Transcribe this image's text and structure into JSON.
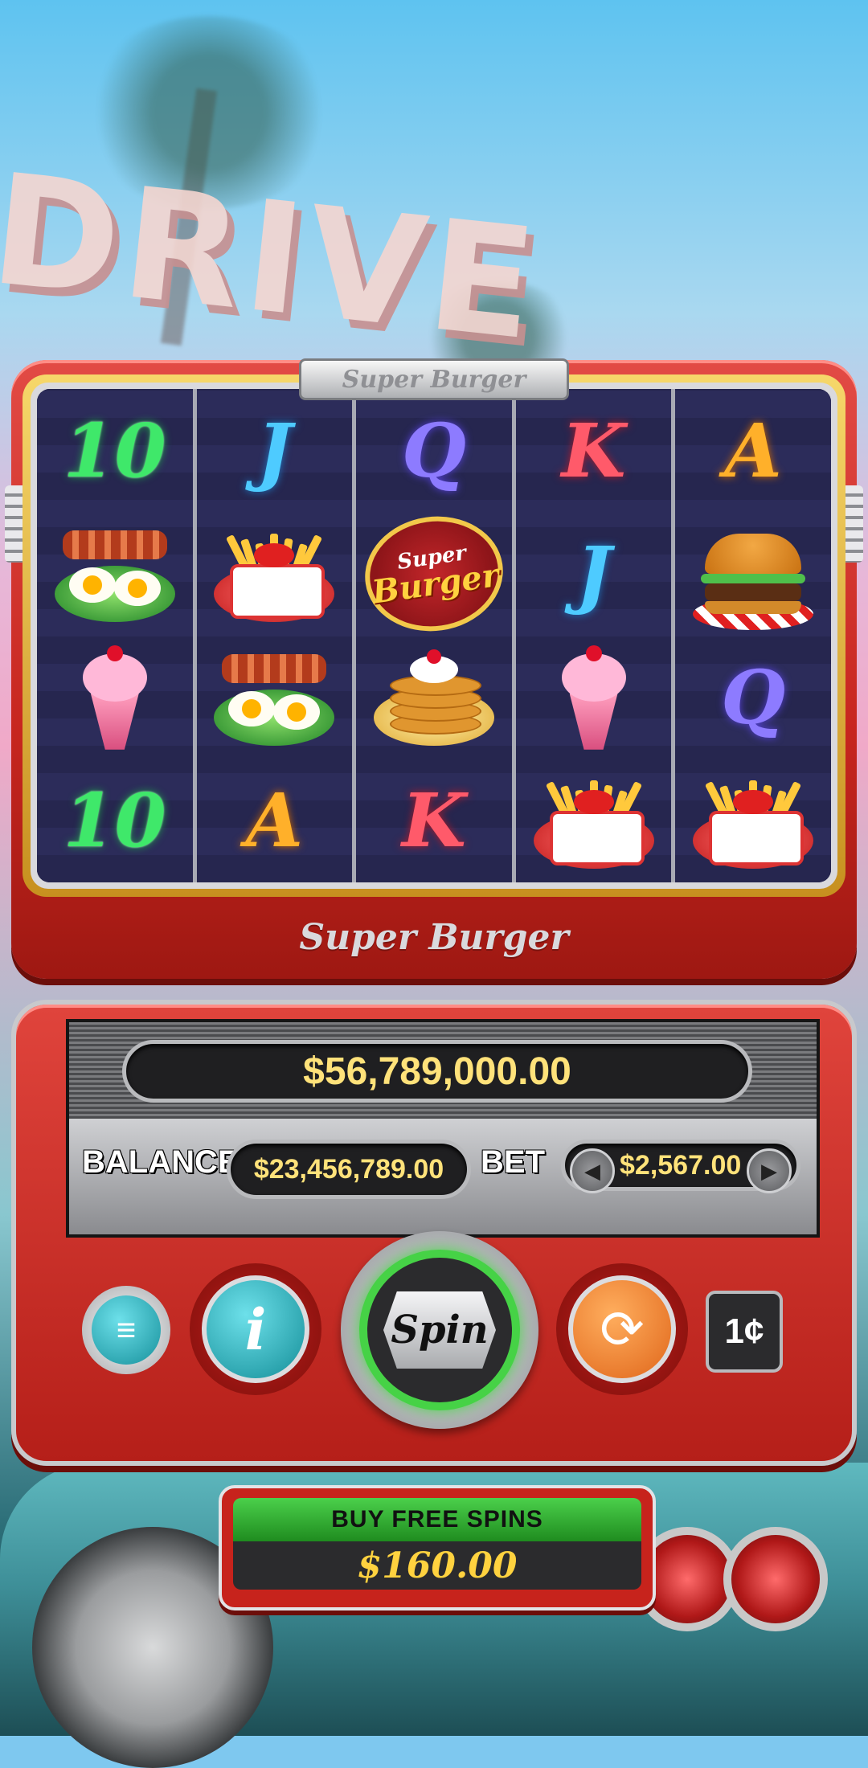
{
  "game": {
    "title": "Super Burger",
    "header_plaque": "Super Burger",
    "footer_logo": "Super Burger",
    "background_sign": "DRIVE"
  },
  "reels": [
    [
      "10",
      "eggs-bacon",
      "sundae",
      "10"
    ],
    [
      "J",
      "fries",
      "eggs-bacon",
      "A"
    ],
    [
      "Q",
      "super-burger-logo",
      "pancakes",
      "K"
    ],
    [
      "K",
      "J",
      "sundae",
      "fries"
    ],
    [
      "A",
      "burger",
      "Q",
      "fries"
    ]
  ],
  "logo_symbol": {
    "line1": "Super",
    "line2": "Burger"
  },
  "hud": {
    "win_display": "$56,789,000.00",
    "balance_label": "BALANCE",
    "balance_value": "$23,456,789.00",
    "bet_label": "BET",
    "bet_value": "$2,567.00",
    "denomination": "1¢"
  },
  "controls": {
    "menu_icon": "hamburger-menu-icon",
    "info_icon": "info-icon",
    "spin_label": "Spin",
    "autoplay_icon": "autoplay-icon",
    "bet_decrease_icon": "arrow-left-icon",
    "bet_increase_icon": "arrow-right-icon"
  },
  "buy_feature": {
    "label": "BUY FREE SPINS",
    "price": "$160.00"
  },
  "colors": {
    "cabinet_red": "#c7261f",
    "value_yellow": "#ffe27a",
    "spin_ring_green": "#46d246",
    "menu_teal": "#16909b",
    "autoplay_orange": "#e0661a"
  }
}
